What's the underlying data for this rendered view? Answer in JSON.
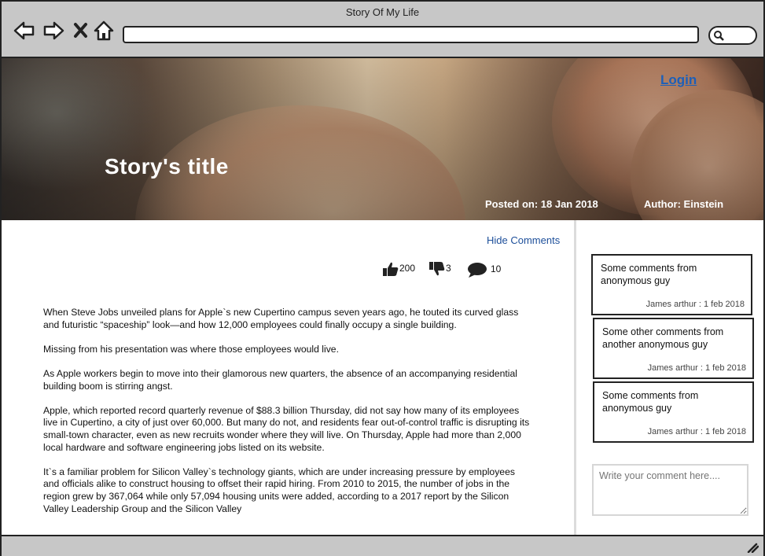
{
  "window": {
    "title": "Story Of My Life"
  },
  "toolbar": {
    "back_icon": "back-arrow-icon",
    "forward_icon": "forward-arrow-icon",
    "close_icon": "close-icon",
    "home_icon": "home-icon",
    "url_value": "",
    "search_icon": "search-icon"
  },
  "hero": {
    "login": "Login",
    "title": "Story's title",
    "posted": "Posted on: 18 Jan 2018",
    "author": "Author: Einstein"
  },
  "content": {
    "hide_comments": "Hide Comments",
    "likes": "200",
    "dislikes": "3",
    "comments_count": "10",
    "paragraphs": [
      "When Steve Jobs unveiled plans for Apple`s new Cupertino campus seven years ago, he touted its curved glass and futuristic “spaceship” look—and how 12,000 employees could finally occupy a single building.",
      "Missing from his presentation was where those employees would live.",
      "As Apple workers begin to move into their glamorous new quarters, the absence of an accompanying residential building boom is stirring angst.",
      "Apple, which reported record quarterly revenue of $88.3 billion Thursday, did not say how many of its employees live in Cupertino, a city of just over 60,000. But many do not, and residents fear out-of-control traffic is disrupting its small-town character, even as new recruits wonder where they will live. On Thursday, Apple had more than 2,000 local hardware and software engineering jobs listed on its website.",
      "It`s a familiar problem for Silicon Valley`s technology giants, which are under increasing pressure by employees and officials alike to construct housing to offset their rapid hiring. From 2010 to 2015, the number of jobs in the region grew by 367,064 while only 57,094 housing units were added, according to a 2017 report by the Silicon Valley Leadership Group and the Silicon Valley"
    ]
  },
  "sidebar": {
    "comments": [
      {
        "text": "Some comments from anonymous guy",
        "meta": "James arthur : 1 feb 2018"
      },
      {
        "text": "Some other comments from another anonymous guy",
        "meta": "James arthur : 1 feb 2018"
      },
      {
        "text": "Some comments from anonymous guy",
        "meta": "James arthur : 1 feb 2018"
      }
    ],
    "input_placeholder": "Write your comment here...."
  }
}
